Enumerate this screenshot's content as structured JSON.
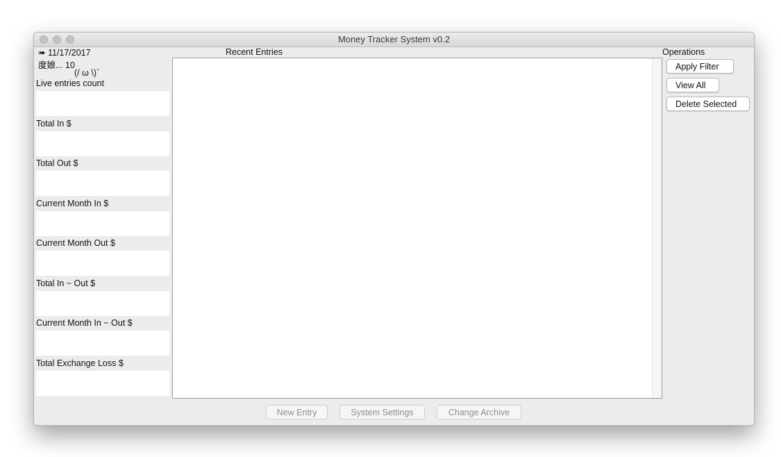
{
  "window": {
    "title": "Money Tracker System v0.2"
  },
  "sidebar": {
    "date": "➠ 11/17/2017",
    "user": "度娘... 10",
    "emoticon": "(/ ω \\)`",
    "stats": [
      {
        "label": "Live entries count",
        "value": ""
      },
      {
        "label": "Total In $",
        "value": ""
      },
      {
        "label": "Total Out $",
        "value": ""
      },
      {
        "label": "Current Month In $",
        "value": ""
      },
      {
        "label": "Current Month Out $",
        "value": ""
      },
      {
        "label": "Total In − Out $",
        "value": ""
      },
      {
        "label": "Current Month In − Out $",
        "value": ""
      },
      {
        "label": "Total Exchange Loss $",
        "value": ""
      }
    ]
  },
  "main": {
    "recent_entries_label": "Recent Entries"
  },
  "operations": {
    "heading": "Operations",
    "apply_filter": "Apply Filter",
    "view_all": "View All",
    "delete_selected": "Delete Selected"
  },
  "footer": {
    "new_entry": "New Entry",
    "system_settings": "System Settings",
    "change_archive": "Change Archive"
  }
}
